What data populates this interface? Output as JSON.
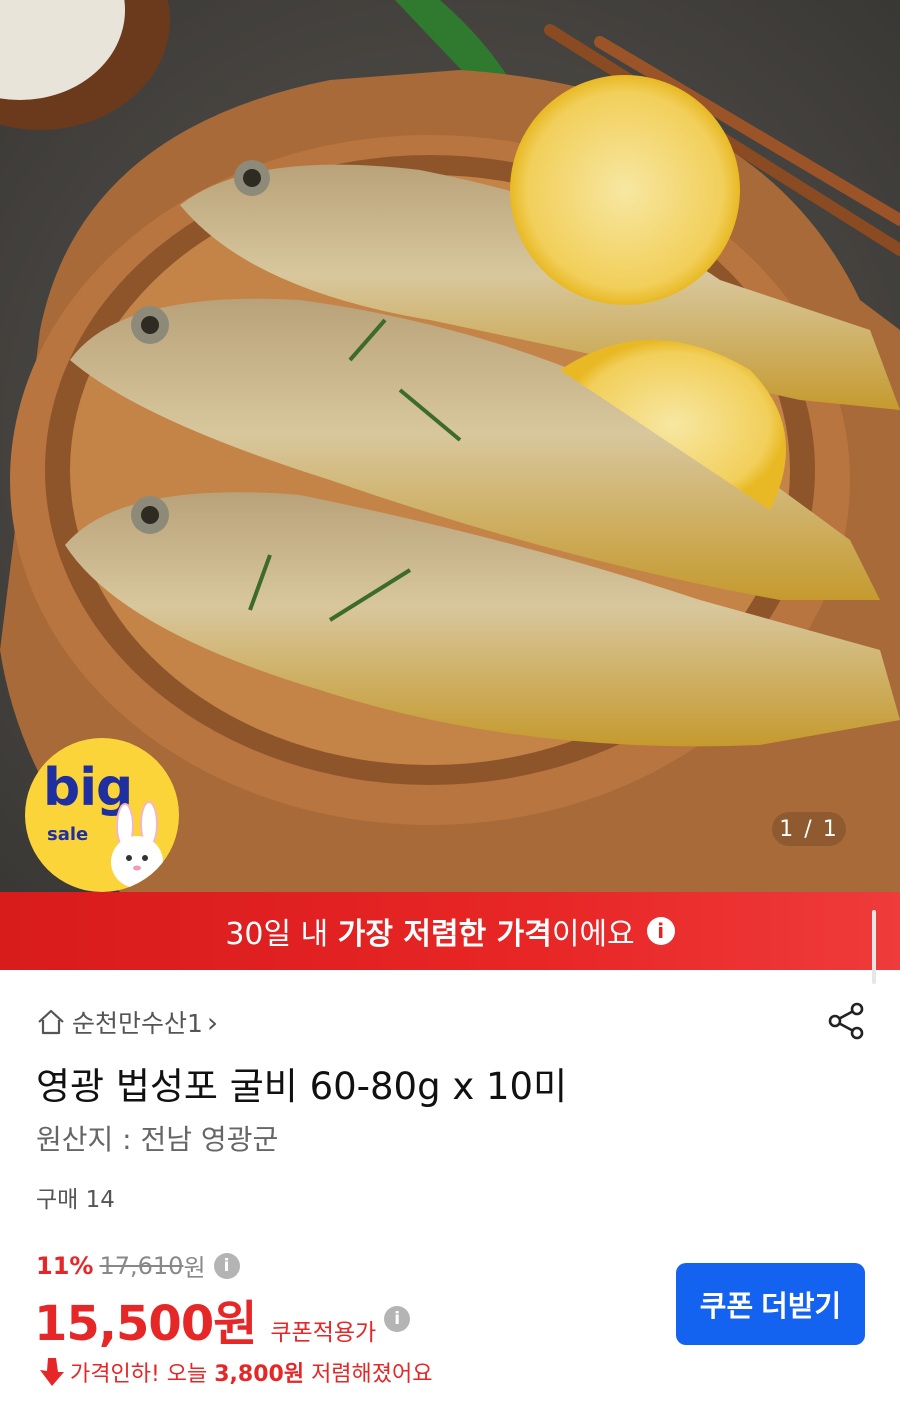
{
  "hero": {
    "image_alt": "grilled yellow croaker on wooden plate",
    "counter": "1 / 1",
    "badge_big": "big",
    "badge_sale": "sale"
  },
  "banner": {
    "text_pre": "30일 내 ",
    "text_bold": "가장 저렴한 가격",
    "text_post": "이에요",
    "info_icon": "i"
  },
  "store": {
    "name": "순천만수산1",
    "chevron": "›"
  },
  "product": {
    "title": "영광 법성포 굴비 60-80g x 10미",
    "origin": "원산지 : 전남 영광군",
    "sold": "구매 14"
  },
  "pricing": {
    "discount": "11%",
    "original_price": "17,610",
    "original_unit": "원",
    "price": "15,500원",
    "coupon_label": "쿠폰적용가",
    "price_cut_pre": "가격인하! 오늘 ",
    "price_cut_bold": "3,800원",
    "price_cut_post": " 저렴해졌어요"
  },
  "actions": {
    "coupon_button": "쿠폰 더받기"
  },
  "colors": {
    "accent_red": "#e52727",
    "button_blue": "#1463f0",
    "badge_yellow": "#fbd43a"
  }
}
